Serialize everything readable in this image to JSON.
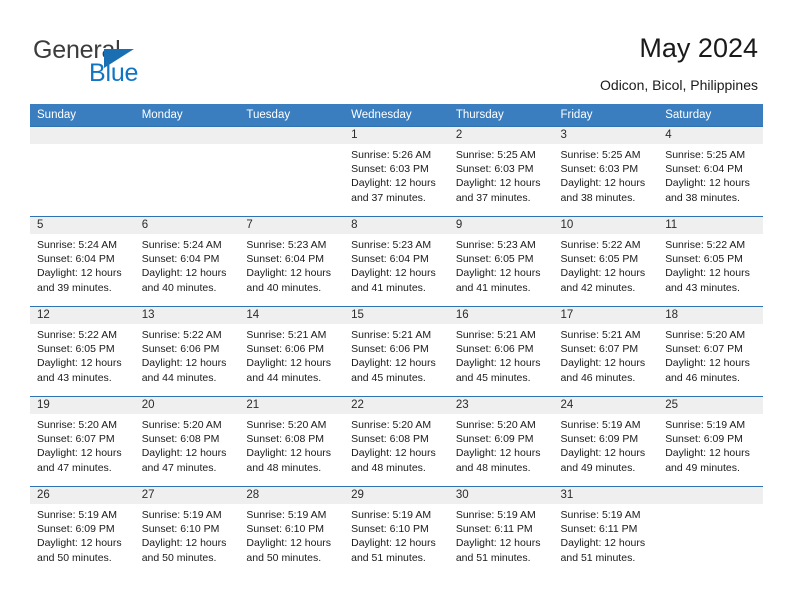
{
  "brand": {
    "name_top": "General",
    "name_bottom": "Blue",
    "color_dark": "#3c3c3c",
    "color_blue": "#1275c4",
    "triangle_color": "#1a6eb2"
  },
  "header": {
    "title": "May 2024",
    "subtitle": "Odicon, Bicol, Philippines"
  },
  "theme": {
    "header_row_bg": "#3a7ebf",
    "header_row_text": "#ffffff",
    "row_separator": "#2f73b3",
    "date_strip_bg": "#efefef",
    "page_bg": "#ffffff"
  },
  "calendar": {
    "weekdays": [
      "Sunday",
      "Monday",
      "Tuesday",
      "Wednesday",
      "Thursday",
      "Friday",
      "Saturday"
    ],
    "labels": {
      "sunrise": "Sunrise:",
      "sunset": "Sunset:",
      "daylight": "Daylight:"
    },
    "weeks": [
      [
        {
          "day": "",
          "empty": true
        },
        {
          "day": "",
          "empty": true
        },
        {
          "day": "",
          "empty": true
        },
        {
          "day": "1",
          "sunrise": "Sunrise: 5:26 AM",
          "sunset": "Sunset: 6:03 PM",
          "daylight": "Daylight: 12 hours and 37 minutes."
        },
        {
          "day": "2",
          "sunrise": "Sunrise: 5:25 AM",
          "sunset": "Sunset: 6:03 PM",
          "daylight": "Daylight: 12 hours and 37 minutes."
        },
        {
          "day": "3",
          "sunrise": "Sunrise: 5:25 AM",
          "sunset": "Sunset: 6:03 PM",
          "daylight": "Daylight: 12 hours and 38 minutes."
        },
        {
          "day": "4",
          "sunrise": "Sunrise: 5:25 AM",
          "sunset": "Sunset: 6:04 PM",
          "daylight": "Daylight: 12 hours and 38 minutes."
        }
      ],
      [
        {
          "day": "5",
          "sunrise": "Sunrise: 5:24 AM",
          "sunset": "Sunset: 6:04 PM",
          "daylight": "Daylight: 12 hours and 39 minutes."
        },
        {
          "day": "6",
          "sunrise": "Sunrise: 5:24 AM",
          "sunset": "Sunset: 6:04 PM",
          "daylight": "Daylight: 12 hours and 40 minutes."
        },
        {
          "day": "7",
          "sunrise": "Sunrise: 5:23 AM",
          "sunset": "Sunset: 6:04 PM",
          "daylight": "Daylight: 12 hours and 40 minutes."
        },
        {
          "day": "8",
          "sunrise": "Sunrise: 5:23 AM",
          "sunset": "Sunset: 6:04 PM",
          "daylight": "Daylight: 12 hours and 41 minutes."
        },
        {
          "day": "9",
          "sunrise": "Sunrise: 5:23 AM",
          "sunset": "Sunset: 6:05 PM",
          "daylight": "Daylight: 12 hours and 41 minutes."
        },
        {
          "day": "10",
          "sunrise": "Sunrise: 5:22 AM",
          "sunset": "Sunset: 6:05 PM",
          "daylight": "Daylight: 12 hours and 42 minutes."
        },
        {
          "day": "11",
          "sunrise": "Sunrise: 5:22 AM",
          "sunset": "Sunset: 6:05 PM",
          "daylight": "Daylight: 12 hours and 43 minutes."
        }
      ],
      [
        {
          "day": "12",
          "sunrise": "Sunrise: 5:22 AM",
          "sunset": "Sunset: 6:05 PM",
          "daylight": "Daylight: 12 hours and 43 minutes."
        },
        {
          "day": "13",
          "sunrise": "Sunrise: 5:22 AM",
          "sunset": "Sunset: 6:06 PM",
          "daylight": "Daylight: 12 hours and 44 minutes."
        },
        {
          "day": "14",
          "sunrise": "Sunrise: 5:21 AM",
          "sunset": "Sunset: 6:06 PM",
          "daylight": "Daylight: 12 hours and 44 minutes."
        },
        {
          "day": "15",
          "sunrise": "Sunrise: 5:21 AM",
          "sunset": "Sunset: 6:06 PM",
          "daylight": "Daylight: 12 hours and 45 minutes."
        },
        {
          "day": "16",
          "sunrise": "Sunrise: 5:21 AM",
          "sunset": "Sunset: 6:06 PM",
          "daylight": "Daylight: 12 hours and 45 minutes."
        },
        {
          "day": "17",
          "sunrise": "Sunrise: 5:21 AM",
          "sunset": "Sunset: 6:07 PM",
          "daylight": "Daylight: 12 hours and 46 minutes."
        },
        {
          "day": "18",
          "sunrise": "Sunrise: 5:20 AM",
          "sunset": "Sunset: 6:07 PM",
          "daylight": "Daylight: 12 hours and 46 minutes."
        }
      ],
      [
        {
          "day": "19",
          "sunrise": "Sunrise: 5:20 AM",
          "sunset": "Sunset: 6:07 PM",
          "daylight": "Daylight: 12 hours and 47 minutes."
        },
        {
          "day": "20",
          "sunrise": "Sunrise: 5:20 AM",
          "sunset": "Sunset: 6:08 PM",
          "daylight": "Daylight: 12 hours and 47 minutes."
        },
        {
          "day": "21",
          "sunrise": "Sunrise: 5:20 AM",
          "sunset": "Sunset: 6:08 PM",
          "daylight": "Daylight: 12 hours and 48 minutes."
        },
        {
          "day": "22",
          "sunrise": "Sunrise: 5:20 AM",
          "sunset": "Sunset: 6:08 PM",
          "daylight": "Daylight: 12 hours and 48 minutes."
        },
        {
          "day": "23",
          "sunrise": "Sunrise: 5:20 AM",
          "sunset": "Sunset: 6:09 PM",
          "daylight": "Daylight: 12 hours and 48 minutes."
        },
        {
          "day": "24",
          "sunrise": "Sunrise: 5:19 AM",
          "sunset": "Sunset: 6:09 PM",
          "daylight": "Daylight: 12 hours and 49 minutes."
        },
        {
          "day": "25",
          "sunrise": "Sunrise: 5:19 AM",
          "sunset": "Sunset: 6:09 PM",
          "daylight": "Daylight: 12 hours and 49 minutes."
        }
      ],
      [
        {
          "day": "26",
          "sunrise": "Sunrise: 5:19 AM",
          "sunset": "Sunset: 6:09 PM",
          "daylight": "Daylight: 12 hours and 50 minutes."
        },
        {
          "day": "27",
          "sunrise": "Sunrise: 5:19 AM",
          "sunset": "Sunset: 6:10 PM",
          "daylight": "Daylight: 12 hours and 50 minutes."
        },
        {
          "day": "28",
          "sunrise": "Sunrise: 5:19 AM",
          "sunset": "Sunset: 6:10 PM",
          "daylight": "Daylight: 12 hours and 50 minutes."
        },
        {
          "day": "29",
          "sunrise": "Sunrise: 5:19 AM",
          "sunset": "Sunset: 6:10 PM",
          "daylight": "Daylight: 12 hours and 51 minutes."
        },
        {
          "day": "30",
          "sunrise": "Sunrise: 5:19 AM",
          "sunset": "Sunset: 6:11 PM",
          "daylight": "Daylight: 12 hours and 51 minutes."
        },
        {
          "day": "31",
          "sunrise": "Sunrise: 5:19 AM",
          "sunset": "Sunset: 6:11 PM",
          "daylight": "Daylight: 12 hours and 51 minutes."
        },
        {
          "day": "",
          "empty": true
        }
      ]
    ]
  }
}
